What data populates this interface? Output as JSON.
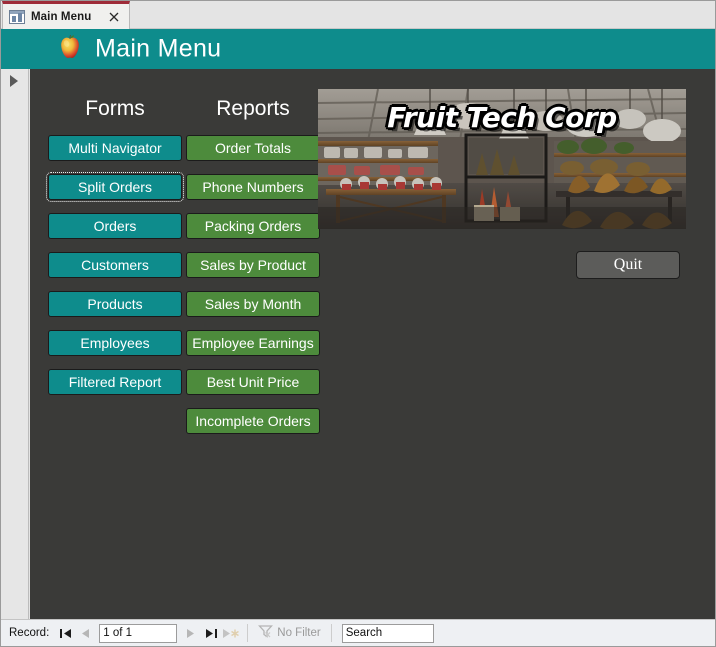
{
  "window": {
    "tab": {
      "title": "Main Menu",
      "icon": "form-window-icon",
      "close_label": "✕"
    }
  },
  "form_header": {
    "title": "Main Menu",
    "icon": "apple-icon",
    "background": "#0e8c8c"
  },
  "nav_pane": {
    "expand_icon": "chevron-right-icon"
  },
  "main": {
    "headings": {
      "forms": "Forms",
      "reports": "Reports"
    },
    "forms_buttons": [
      {
        "label": "Multi Navigator",
        "focused": false
      },
      {
        "label": "Split Orders",
        "focused": true
      },
      {
        "label": "Orders",
        "focused": false
      },
      {
        "label": "Customers",
        "focused": false
      },
      {
        "label": "Products",
        "focused": false
      },
      {
        "label": "Employees",
        "focused": false
      },
      {
        "label": "Filtered Report",
        "focused": false
      }
    ],
    "reports_buttons": [
      {
        "label": "Order Totals",
        "focused": false
      },
      {
        "label": "Phone Numbers",
        "focused": false
      },
      {
        "label": "Packing Orders",
        "focused": false
      },
      {
        "label": "Sales by Product",
        "focused": false
      },
      {
        "label": "Sales by Month",
        "focused": false
      },
      {
        "label": "Employee Earnings",
        "focused": false
      },
      {
        "label": "Best Unit Price",
        "focused": false
      },
      {
        "label": "Incomplete Orders",
        "focused": false
      }
    ],
    "quit_label": "Quit",
    "banner": {
      "caption": "Fruit Tech Corp",
      "description": "retail store interior with shelves, tables of goods and hanging pendant lights"
    },
    "colors": {
      "form_background": "#3a3a38",
      "forms_button": "#0e8c8c",
      "reports_button": "#4d8b3c",
      "quit_button": "#5c5c5a"
    }
  },
  "status_bar": {
    "record_label": "Record:",
    "first_icon": "first-record-icon",
    "prev_icon": "previous-record-icon",
    "record_value": "1 of 1",
    "next_icon": "next-record-icon",
    "last_icon": "last-record-icon",
    "new_icon": "new-record-icon",
    "filter_icon": "filter-funnel-icon",
    "filter_label": "No Filter",
    "search_value": "Search"
  }
}
